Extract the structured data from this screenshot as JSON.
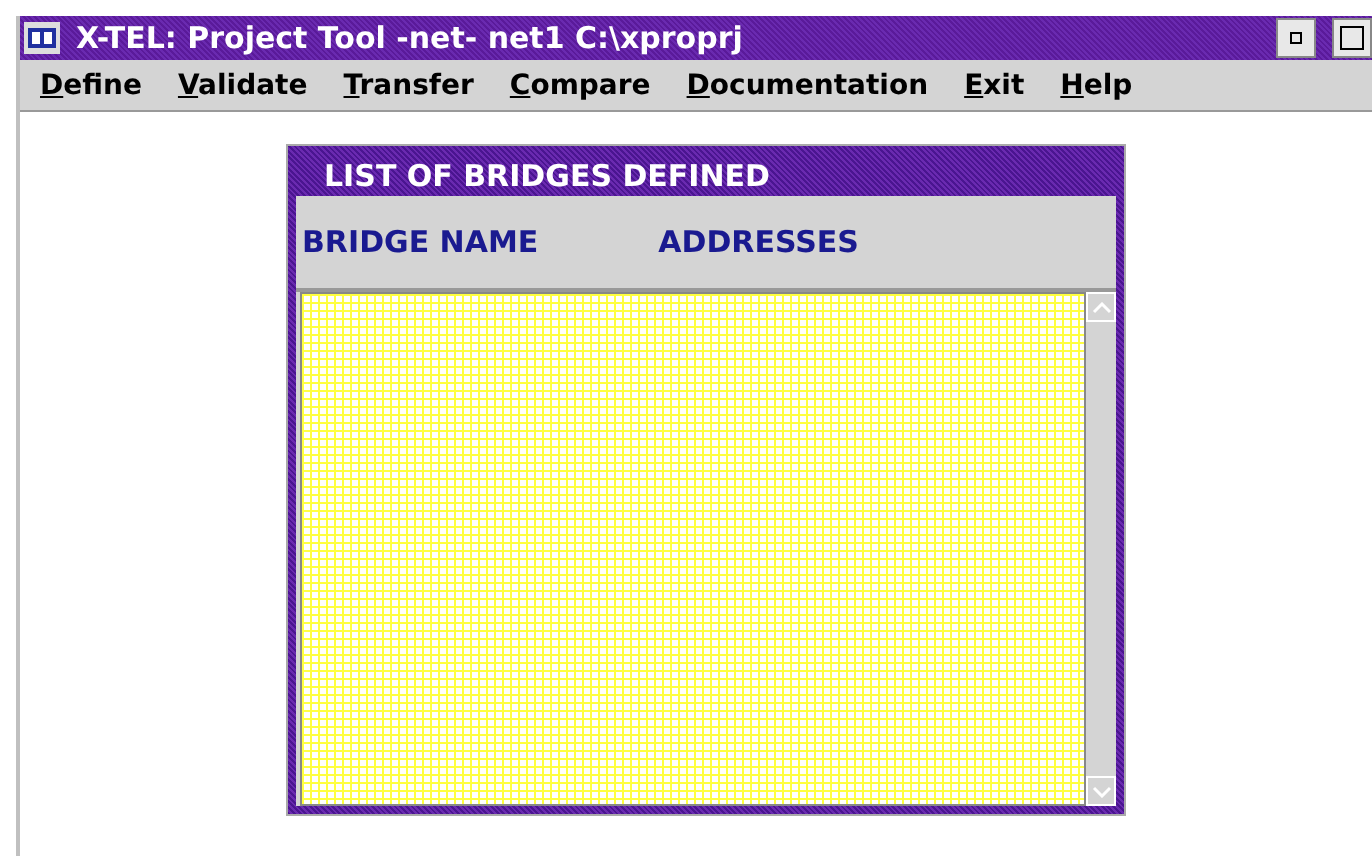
{
  "window": {
    "title": "X-TEL: Project Tool -net- net1 C:\\xproprj"
  },
  "menu": [
    "Define",
    "Validate",
    "Transfer",
    "Compare",
    "Documentation",
    "Exit",
    "Help"
  ],
  "dialog": {
    "title": "LIST OF BRIDGES DEFINED",
    "columns": [
      "BRIDGE NAME",
      "ADDRESSES"
    ]
  }
}
